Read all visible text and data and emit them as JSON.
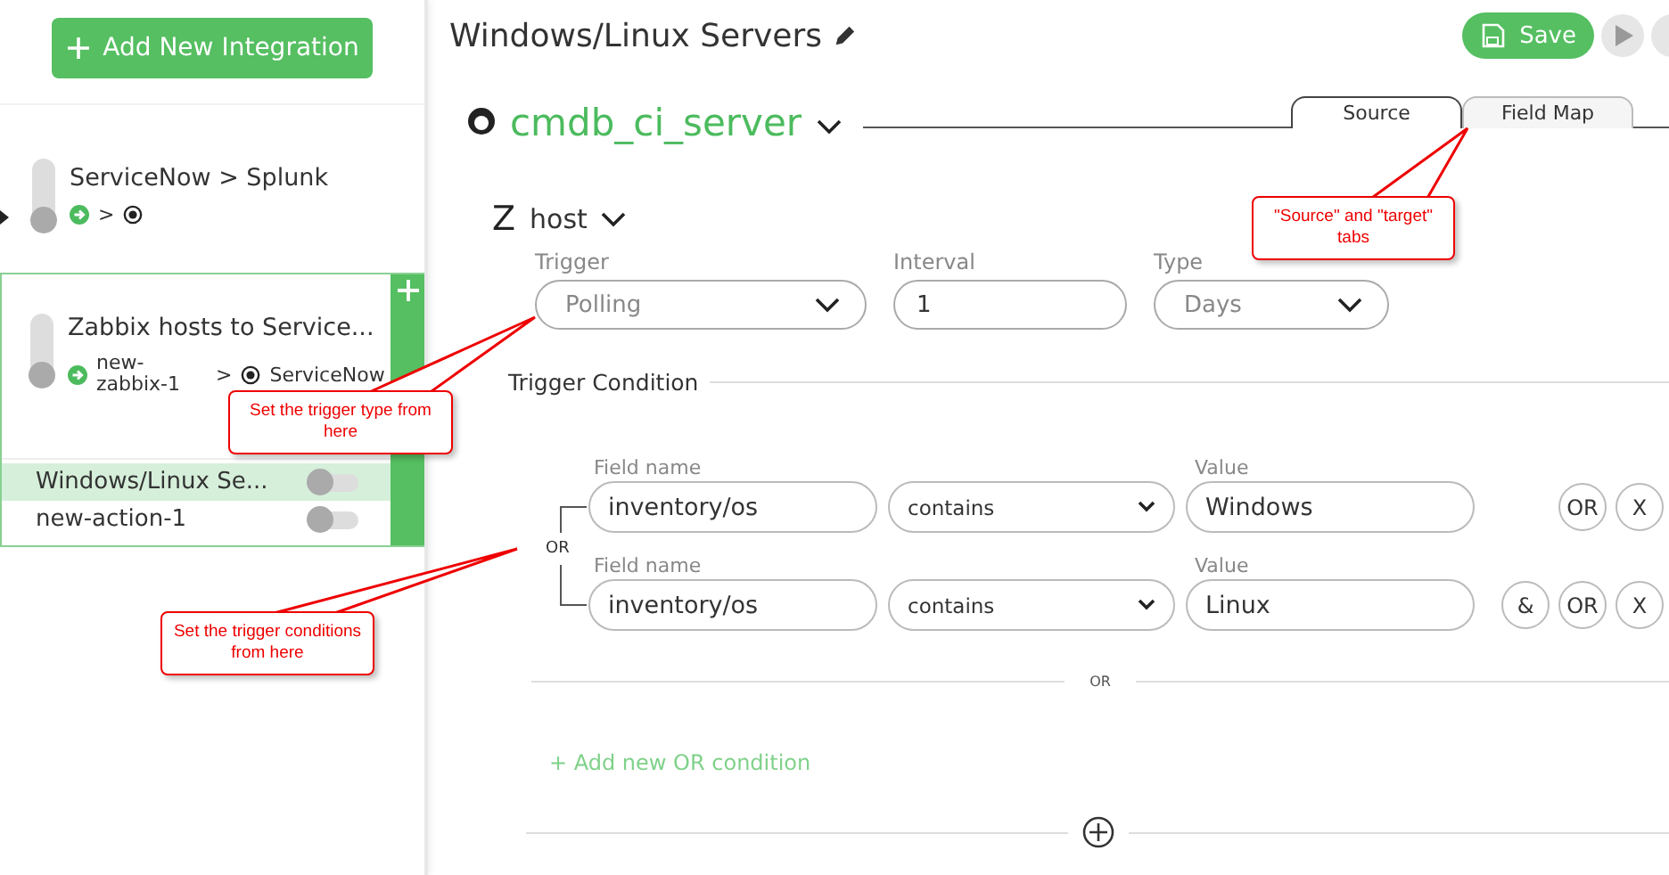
{
  "sidebar": {
    "add_button": "Add New Integration",
    "integrations": [
      {
        "title": "ServiceNow > Splunk",
        "selected": false,
        "enabled": false,
        "separator": ">"
      },
      {
        "title": "Zabbix hosts to Service...",
        "selected": true,
        "enabled": false,
        "source_label": "new-zabbix-1",
        "separator": ">",
        "target_label": "ServiceNow",
        "actions": [
          {
            "name": "Windows/Linux Se...",
            "selected": true,
            "on": false
          },
          {
            "name": "new-action-1",
            "selected": false,
            "on": false
          }
        ]
      }
    ]
  },
  "header": {
    "title": "Windows/Linux Servers",
    "save_button": "Save"
  },
  "entity": {
    "name": "cmdb_ci_server",
    "tabs": [
      {
        "label": "Source",
        "selected": true
      },
      {
        "label": "Field Map",
        "selected": false
      }
    ]
  },
  "host": {
    "logo_letter": "Z",
    "name": "host"
  },
  "trigger": {
    "fields": [
      {
        "kind": "select",
        "label": "Trigger",
        "value": "Polling"
      },
      {
        "kind": "input",
        "label": "Interval",
        "value": "1"
      },
      {
        "kind": "select",
        "label": "Type",
        "value": "Days"
      }
    ]
  },
  "trigger_condition": {
    "title": "Trigger Condition",
    "group_label": "OR",
    "rows": [
      {
        "field_label": "Field name",
        "field": "inventory/os",
        "operator": "contains",
        "value_label": "Value",
        "value": "Windows",
        "buttons": [
          "OR",
          "X"
        ]
      },
      {
        "field_label": "Field name",
        "field": "inventory/os",
        "operator": "contains",
        "value_label": "Value",
        "value": "Linux",
        "buttons": [
          "&",
          "OR",
          "X"
        ]
      }
    ],
    "divider": "OR",
    "add_link": "+ Add new OR condition"
  },
  "callouts": [
    {
      "text": "Set the trigger type from here"
    },
    {
      "text": "Set the trigger conditions from here"
    },
    {
      "text": "\"Source\" and \"target\" tabs"
    }
  ]
}
